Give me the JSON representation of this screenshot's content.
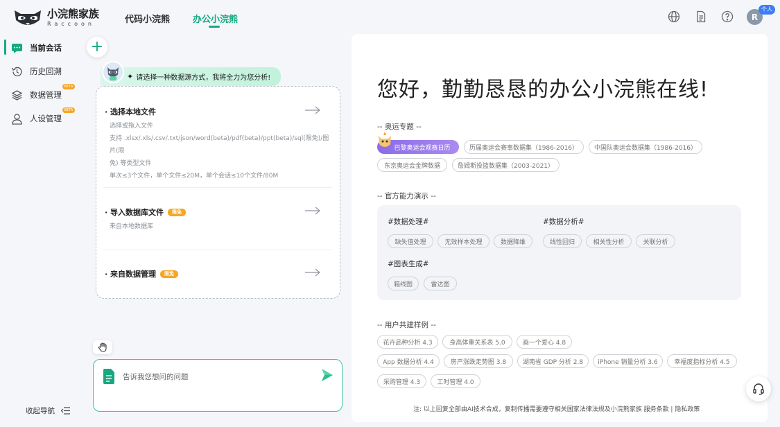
{
  "header": {
    "brand_cn": "小浣熊家族",
    "brand_en": "Raccoon",
    "tabs": [
      {
        "label": "代码小浣熊"
      },
      {
        "label": "办公小浣熊"
      }
    ],
    "avatar_letter": "R",
    "avatar_badge": "个人",
    "icons": [
      "globe-icon",
      "document-icon",
      "help-icon"
    ]
  },
  "sidebar": {
    "items": [
      {
        "label": "当前会话",
        "icon": "chat-icon"
      },
      {
        "label": "历史回溯",
        "icon": "history-icon"
      },
      {
        "label": "数据管理",
        "icon": "layers-icon",
        "badge": "BETA"
      },
      {
        "label": "人设管理",
        "icon": "person-icon",
        "badge": "BETA"
      }
    ],
    "collapse_label": "收起导航"
  },
  "middle": {
    "prompt": "请选择一种数据源方式，我将全力为您分析!",
    "options": [
      {
        "title": "· 选择本地文件",
        "desc": [
          "选择或拖入文件",
          "支持 .xlsx/.xls/.csv/.txt/json/word(beta)/pdf(beta)/ppt(beta)/sql(限免)/图片(限",
          "免) 等类型文件",
          "单次≤3个文件，单个文件≤20M，单个会话≤10个文件/80M"
        ]
      },
      {
        "title": "· 导入数据库文件",
        "badge": "限免",
        "desc": [
          "来自本地数据库"
        ]
      },
      {
        "title": "· 来自数据管理",
        "badge": "限免"
      }
    ],
    "input_placeholder": "告诉我您想问的问题"
  },
  "right": {
    "greeting": "您好，勤勤恳恳的办公小浣熊在线!",
    "olympic_title": "-- 奥运专题 --",
    "olympic_chips": [
      "巴黎奥运会观赛日历",
      "历届奥运会赛事数据集（1986-2016）",
      "中国队奥运会数据集（1986-2016）",
      "东京奥运会金牌数据",
      "詹姆斯投篮数据集（2003-2021）"
    ],
    "official_title": "-- 官方能力演示 --",
    "cap_groups": [
      {
        "title": "#数据处理#",
        "chips": [
          "缺失值处理",
          "无效样本处理",
          "数据降维"
        ]
      },
      {
        "title": "#数据分析#",
        "chips": [
          "线性回归",
          "相关性分析",
          "关联分析"
        ]
      },
      {
        "title": "#图表生成#",
        "chips": [
          "箱线图",
          "雷达图"
        ]
      }
    ],
    "user_title": "-- 用户共建样例 --",
    "user_chips": [
      "花卉品种分析 4.3",
      "身高体重关系表 5.0",
      "画一个爱心 4.8",
      "App 数据分析 4.4",
      "房产涨跌走势图 3.8",
      "湖南省 GDP 分析 2.8",
      "iPhone 销量分析 3.6",
      "幸福度指标分析 4.5",
      "采购管理 4.3",
      "工时管理 4.0"
    ],
    "footer": "注: 以上回复全部由AI技术合成，复制传播需要遵守相关国家法律法规及小浣熊家族 服务条款 | 隐私政策"
  }
}
